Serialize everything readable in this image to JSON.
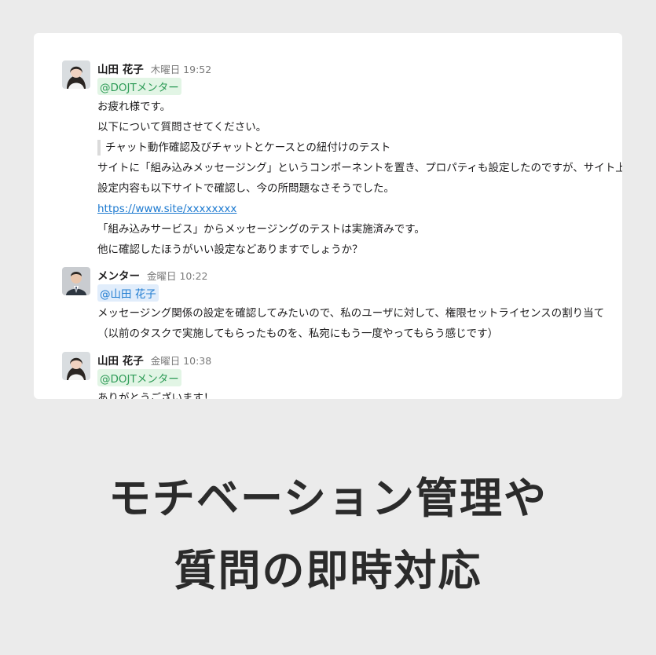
{
  "messages": [
    {
      "name": "山田 花子",
      "time": "木曜日 19:52",
      "mention": "@DOJTメンター",
      "lines": [
        "お疲れ様です。",
        "以下について質問させてください。",
        "チャット動作確認及びチャットとケースとの紐付けのテスト",
        "サイトに「組み込みメッセージング」というコンポーネントを置き、プロパティも設定したのですが、サイト上",
        "設定内容も以下サイトで確認し、今の所問題なさそうでした。",
        "https://www.site/xxxxxxxx",
        "「組み込みサービス」からメッセージングのテストは実施済みです。",
        "他に確認したほうがいい設定などありますでしょうか？"
      ]
    },
    {
      "name": "メンター",
      "time": "金曜日 10:22",
      "mention": "@山田 花子",
      "lines": [
        "メッセージング関係の設定を確認してみたいので、私のユーザに対して、権限セットライセンスの割り当て",
        "（以前のタスクで実施してもらったものを、私宛にもう一度やってもらう感じです）"
      ]
    },
    {
      "name": "山田 花子",
      "time": "金曜日 10:38",
      "mention": "@DOJTメンター",
      "lines": [
        "ありがとうございます！"
      ]
    }
  ],
  "caption": {
    "line1": "モチベーション管理や",
    "line2": "質問の即時対応"
  },
  "colors": {
    "mention_green_bg": "#e2f5e5",
    "mention_green_text": "#2d9b56",
    "mention_blue_bg": "#e1edfb",
    "mention_blue_text": "#1d7ad0",
    "link": "#1d7ad0"
  }
}
